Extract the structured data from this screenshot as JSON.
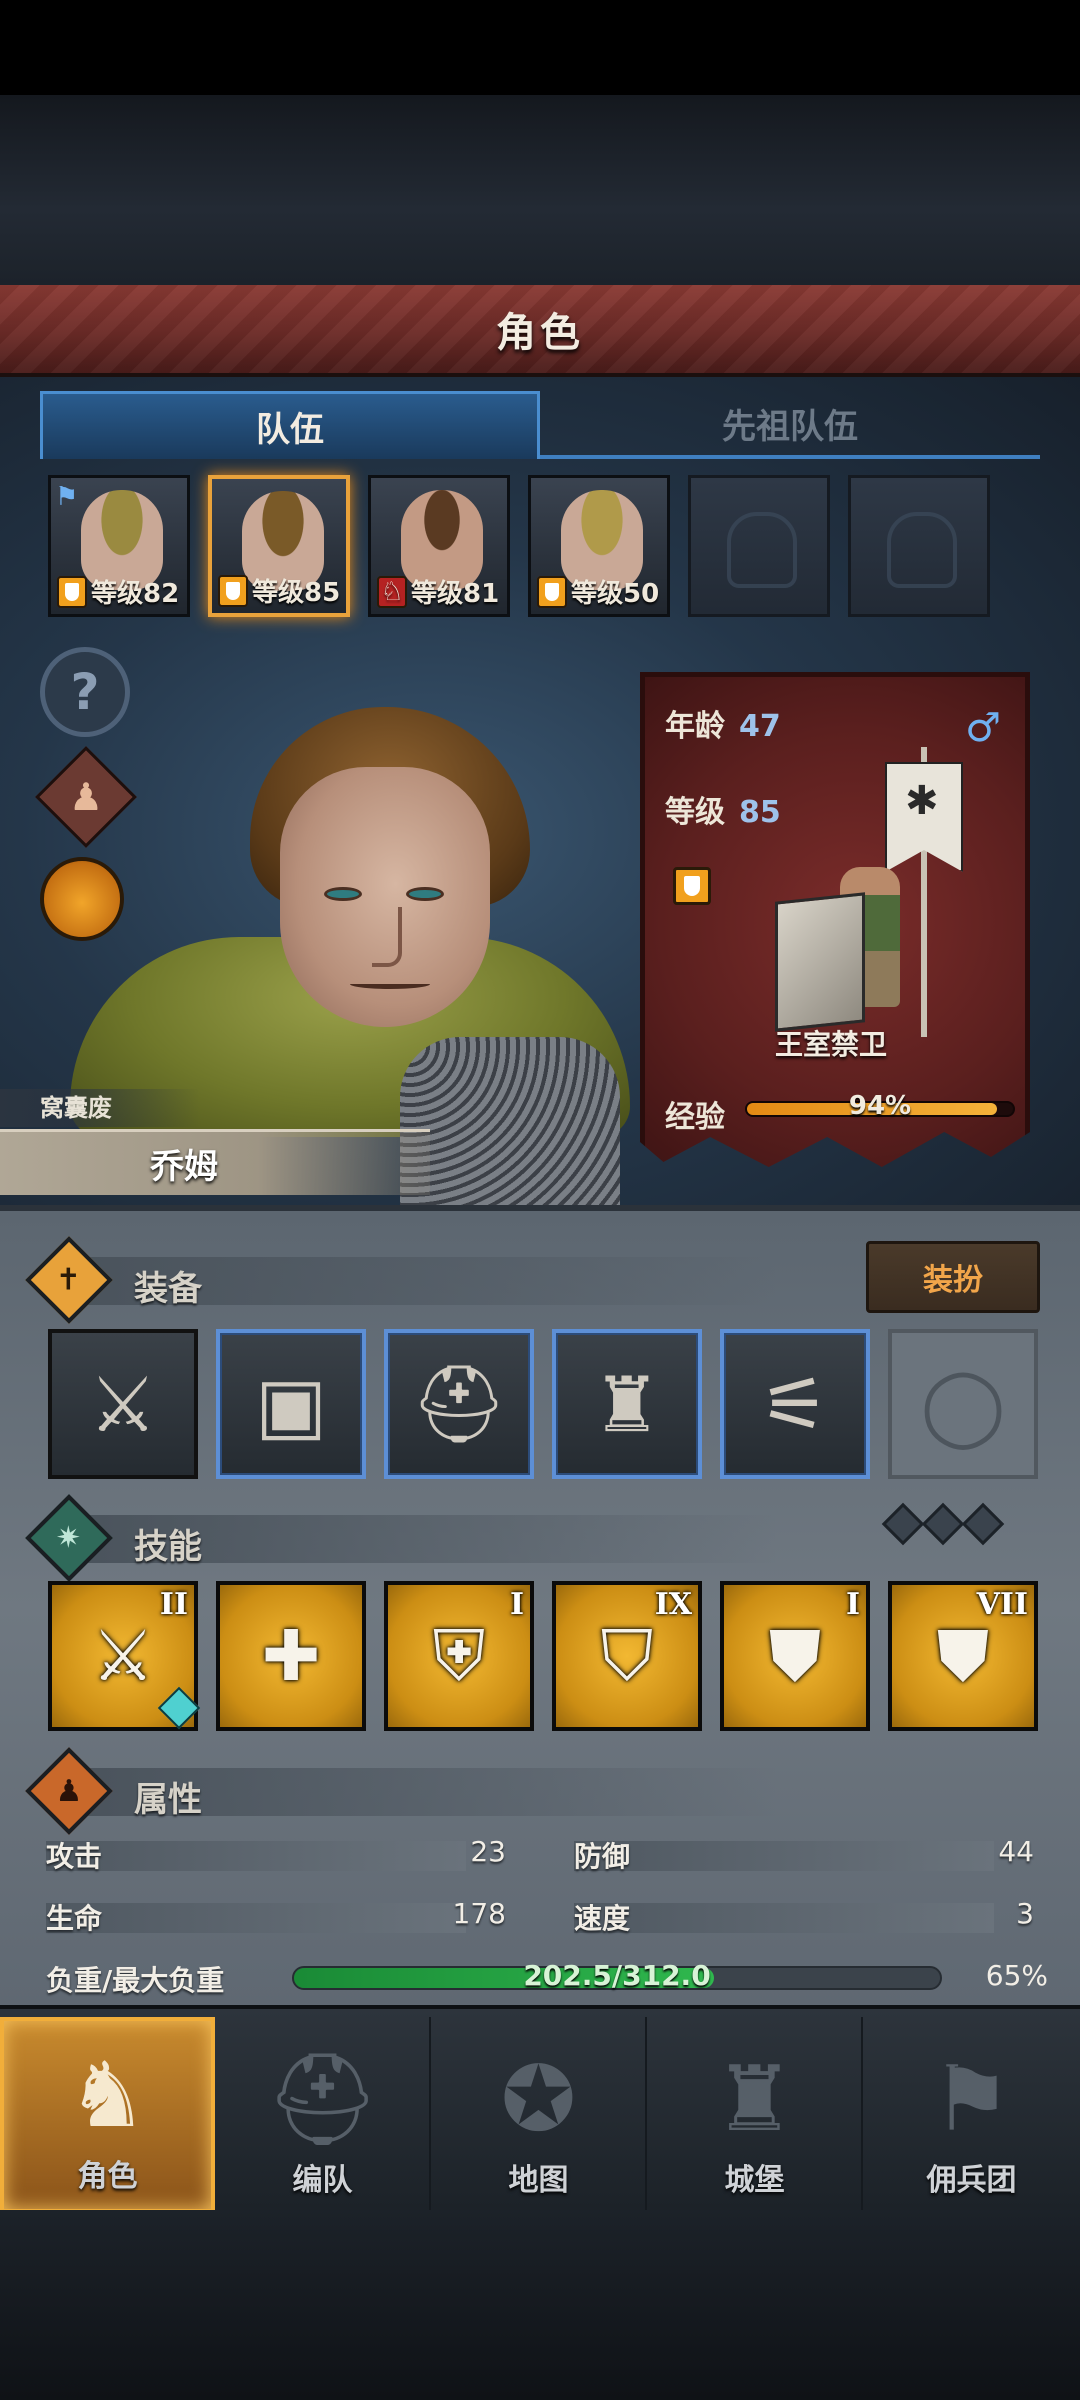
{
  "header": {
    "title": "角色"
  },
  "tabs": [
    {
      "label": "队伍",
      "active": true
    },
    {
      "label": "先祖队伍",
      "active": false
    }
  ],
  "roster": [
    {
      "level": "等级82",
      "badge": "shield",
      "flag": true,
      "hair": "#9a8a40",
      "empty": false
    },
    {
      "level": "等级85",
      "badge": "shield",
      "flag": false,
      "selected": true,
      "hair": "#7a5a28",
      "empty": false
    },
    {
      "level": "等级81",
      "badge": "horse",
      "flag": false,
      "hair": "#5a3a22",
      "empty": false
    },
    {
      "level": "等级50",
      "badge": "shield",
      "flag": false,
      "hair": "#b09a4a",
      "empty": false
    },
    {
      "empty": true
    },
    {
      "empty": true
    }
  ],
  "side_icons": [
    "help-icon",
    "character-icon",
    "potion-icon"
  ],
  "help_glyph": "?",
  "character": {
    "title": "窝囊废",
    "name": "乔姆"
  },
  "info": {
    "age_label": "年龄",
    "age": "47",
    "level_label": "等级",
    "level": "85",
    "gender_symbol": "♂",
    "class_name": "王室禁卫",
    "exp_label": "经验",
    "exp_text": "94%",
    "exp_value": 0.94
  },
  "equipment": {
    "section_label": "装备",
    "section_icon": "✝",
    "dress_button": "装扮",
    "items": [
      {
        "name": "banner-weapon",
        "glyph": "⚔",
        "blue": false
      },
      {
        "name": "tower-shield",
        "glyph": "▣",
        "blue": true
      },
      {
        "name": "helmet",
        "glyph": "⛑",
        "blue": true
      },
      {
        "name": "chest-armor",
        "glyph": "♜",
        "blue": true
      },
      {
        "name": "greaves",
        "glyph": "⚟",
        "blue": true
      },
      {
        "name": "ring",
        "glyph": "◯",
        "empty": true
      }
    ]
  },
  "skills": {
    "section_label": "技能",
    "section_icon": "✷",
    "items": [
      {
        "glyph": "⚔",
        "rank": "II",
        "gem": true
      },
      {
        "glyph": "✚",
        "rank": ""
      },
      {
        "glyph": "⛨",
        "rank": "I"
      },
      {
        "glyph": "⛉",
        "rank": "IX"
      },
      {
        "glyph": "⛊",
        "rank": "I"
      },
      {
        "glyph": "⛊",
        "rank": "VII"
      }
    ]
  },
  "attributes": {
    "section_label": "属性",
    "section_icon": "♟",
    "attack_label": "攻击",
    "attack": "23",
    "defense_label": "防御",
    "defense": "44",
    "life_label": "生命",
    "life": "178",
    "speed_label": "速度",
    "speed": "3",
    "load_label": "负重/最大负重",
    "load_text": "202.5/312.0",
    "load_pct": "65%",
    "load_value": 0.65
  },
  "nav": [
    {
      "label": "角色",
      "icon": "♞",
      "active": true
    },
    {
      "label": "编队",
      "icon": "⛑",
      "active": false
    },
    {
      "label": "地图",
      "icon": "✪",
      "active": false
    },
    {
      "label": "城堡",
      "icon": "♜",
      "active": false
    },
    {
      "label": "佣兵团",
      "icon": "⚑",
      "active": false
    }
  ],
  "colors": {
    "accent": "#f1a01d",
    "banner": "#6c2b27",
    "tab_blue": "#3f7fc0"
  }
}
